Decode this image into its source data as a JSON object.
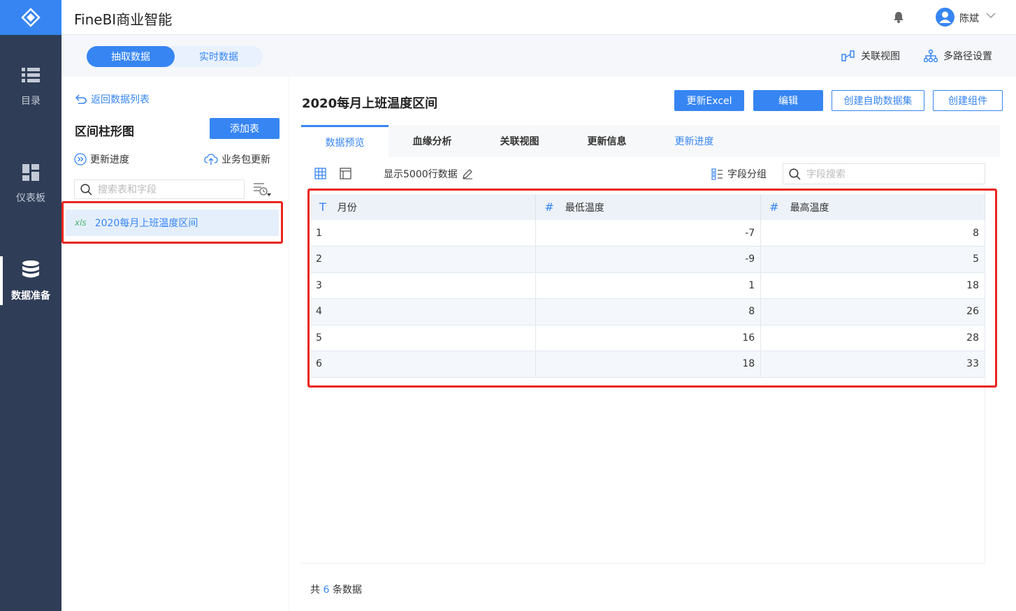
{
  "app": {
    "title": "FineBI商业智能"
  },
  "nav": {
    "items": [
      {
        "label": "目录",
        "icon": "list-icon"
      },
      {
        "label": "仪表板",
        "icon": "dashboard-icon"
      },
      {
        "label": "数据准备",
        "icon": "database-icon",
        "active": true
      }
    ]
  },
  "user": {
    "name": "陈斌"
  },
  "data_mode": {
    "extract": "抽取数据",
    "realtime": "实时数据",
    "active": "抽取数据"
  },
  "top_links": {
    "relation_view": "关联视图",
    "multipath": "多路径设置"
  },
  "left_panel": {
    "back": "返回数据列表",
    "group_title": "区间柱形图",
    "add_table": "添加表",
    "update_progress": "更新进度",
    "package_update": "业务包更新",
    "search_placeholder": "搜索表和字段",
    "tables": [
      {
        "type": "xls",
        "name": "2020每月上班温度区间",
        "selected": true
      }
    ]
  },
  "main": {
    "title": "2020每月上班温度区间",
    "buttons": {
      "update_excel": "更新Excel",
      "edit": "编辑",
      "create_dataset": "创建自助数据集",
      "create_component": "创建组件"
    },
    "tabs": [
      {
        "label": "数据预览",
        "active": true
      },
      {
        "label": "血缘分析"
      },
      {
        "label": "关联视图"
      },
      {
        "label": "更新信息"
      },
      {
        "label": "更新进度",
        "link": true
      }
    ],
    "toolbar": {
      "rows_label": "显示5000行数据",
      "field_group": "字段分组",
      "field_search_placeholder": "字段搜索"
    },
    "table": {
      "columns": [
        {
          "type": "T",
          "name": "月份"
        },
        {
          "type": "#",
          "name": "最低温度"
        },
        {
          "type": "#",
          "name": "最高温度"
        }
      ],
      "rows": [
        [
          "1",
          "-7",
          "8"
        ],
        [
          "2",
          "-9",
          "5"
        ],
        [
          "3",
          "1",
          "18"
        ],
        [
          "4",
          "8",
          "26"
        ],
        [
          "5",
          "16",
          "28"
        ],
        [
          "6",
          "18",
          "33"
        ]
      ]
    },
    "footer": {
      "prefix": "共",
      "count": "6",
      "suffix": "条数据"
    }
  },
  "colors": {
    "primary": "#3685f2",
    "nav_bg": "#2f3d57",
    "highlight_border": "#e8261b",
    "xls_green": "#4cb66f"
  }
}
